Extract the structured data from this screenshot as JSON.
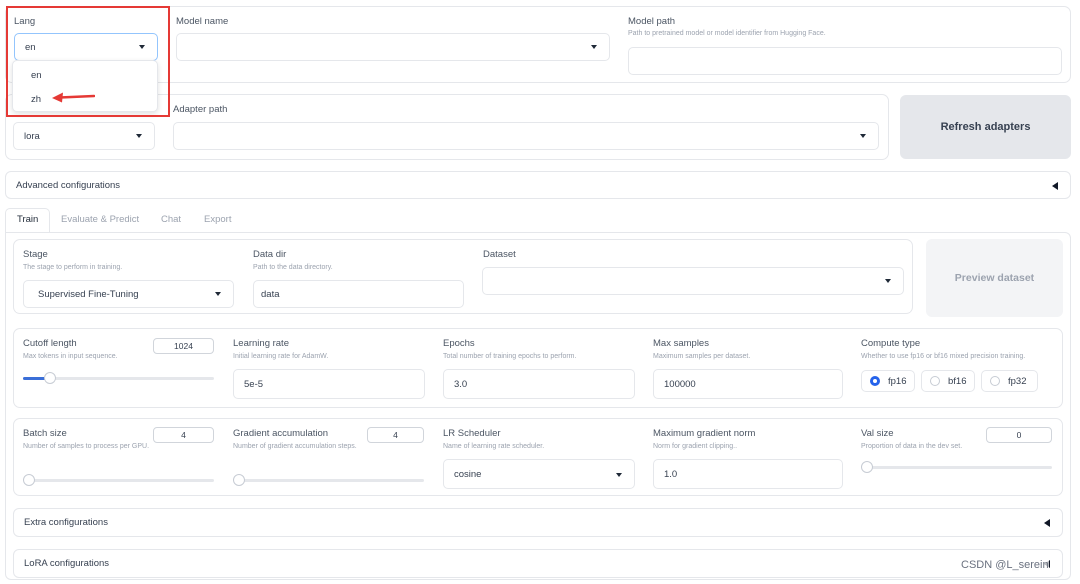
{
  "top": {
    "lang": {
      "label": "Lang",
      "value": "en",
      "options": [
        "en",
        "zh"
      ]
    },
    "model_name": {
      "label": "Model name",
      "value": ""
    },
    "model_path": {
      "label": "Model path",
      "description": "Path to pretrained model or model identifier from Hugging Face.",
      "value": ""
    },
    "finetuning_method": {
      "value": "lora"
    },
    "adapter_path": {
      "label": "Adapter path",
      "value": ""
    },
    "refresh_label": "Refresh adapters"
  },
  "advanced_label": "Advanced configurations",
  "tabs": [
    "Train",
    "Evaluate & Predict",
    "Chat",
    "Export"
  ],
  "train": {
    "stage": {
      "label": "Stage",
      "description": "The stage to perform in training.",
      "value": "Supervised Fine-Tuning"
    },
    "data_dir": {
      "label": "Data dir",
      "description": "Path to the data directory.",
      "value": "data"
    },
    "dataset": {
      "label": "Dataset",
      "value": ""
    },
    "preview_label": "Preview dataset",
    "cutoff": {
      "label": "Cutoff length",
      "description": "Max tokens in input sequence.",
      "value": "1024",
      "fill": 0.12
    },
    "lr": {
      "label": "Learning rate",
      "description": "Initial learning rate for AdamW.",
      "value": "5e-5"
    },
    "epochs": {
      "label": "Epochs",
      "description": "Total number of training epochs to perform.",
      "value": "3.0"
    },
    "max_samples": {
      "label": "Max samples",
      "description": "Maximum samples per dataset.",
      "value": "100000"
    },
    "compute": {
      "label": "Compute type",
      "description": "Whether to use fp16 or bf16 mixed precision training.",
      "options": [
        "fp16",
        "bf16",
        "fp32"
      ],
      "selected": "fp16"
    },
    "batch": {
      "label": "Batch size",
      "description": "Number of samples to process per GPU.",
      "value": "4",
      "fill": 0.0
    },
    "grad_acc": {
      "label": "Gradient accumulation",
      "description": "Number of gradient accumulation steps.",
      "value": "4",
      "fill": 0.0
    },
    "scheduler": {
      "label": "LR Scheduler",
      "description": "Name of learning rate scheduler.",
      "value": "cosine"
    },
    "max_grad_norm": {
      "label": "Maximum gradient norm",
      "description": "Norm for gradient clipping..",
      "value": "1.0"
    },
    "val_size": {
      "label": "Val size",
      "description": "Proportion of data in the dev set.",
      "value": "0",
      "fill": 0.0
    }
  },
  "extra_label": "Extra configurations",
  "lora_label": "LoRA configurations",
  "watermark": "CSDN @L_serein",
  "colors": {
    "accent": "#3b6fd8",
    "highlight_box": "#e53935",
    "arrow": "#e53935"
  }
}
